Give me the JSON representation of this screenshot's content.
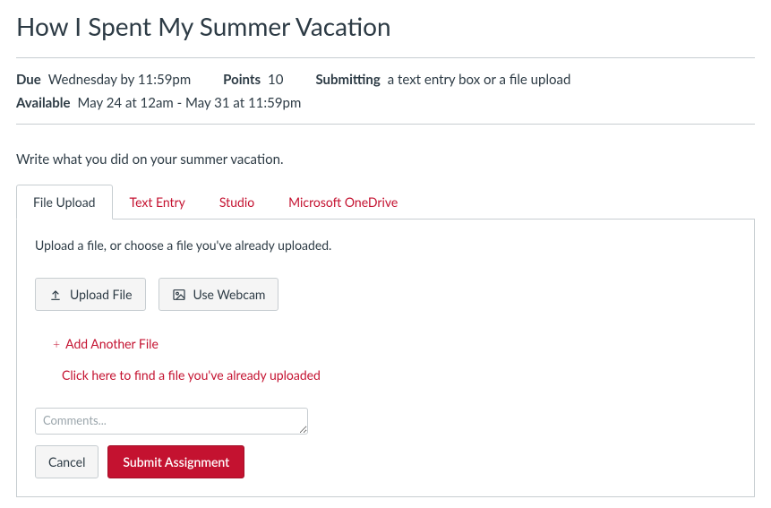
{
  "title": "How I Spent My Summer Vacation",
  "meta": {
    "due_label": "Due",
    "due_value": "Wednesday by 11:59pm",
    "points_label": "Points",
    "points_value": "10",
    "submitting_label": "Submitting",
    "submitting_value": "a text entry box or a file upload",
    "available_label": "Available",
    "available_value": "May 24 at 12am - May 31 at 11:59pm"
  },
  "instructions": "Write what you did on your summer vacation.",
  "tabs": {
    "file_upload": "File Upload",
    "text_entry": "Text Entry",
    "studio": "Studio",
    "onedrive": "Microsoft OneDrive"
  },
  "panel": {
    "hint": "Upload a file, or choose a file you've already uploaded.",
    "upload_btn": "Upload File",
    "webcam_btn": "Use Webcam",
    "add_another": "Add Another File",
    "find_existing": "Click here to find a file you've already uploaded",
    "comments_placeholder": "Comments...",
    "cancel": "Cancel",
    "submit": "Submit Assignment"
  }
}
